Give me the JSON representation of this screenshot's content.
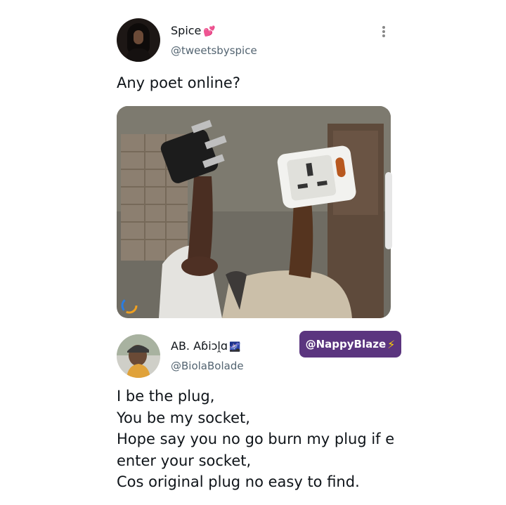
{
  "tweet": {
    "author_name": "Spice",
    "author_emoji": "💕",
    "author_handle": "@tweetsbyspice",
    "text": "Any poet online?",
    "menu_icon": "more-vertical-icon"
  },
  "reply": {
    "author_name": "AB. Aɓiɔḽɑ",
    "author_emoji": "🌌",
    "author_handle": "@BiolaBolade",
    "lines": [
      "I be the plug,",
      "You be my socket,",
      "Hope say you no go burn my plug if e",
      "enter your socket,",
      "Cos original plug no easy to find."
    ]
  },
  "watermark": {
    "label": "@NappyBlaze",
    "icon": "lightning-bolt-icon",
    "color": "#5b357f"
  }
}
